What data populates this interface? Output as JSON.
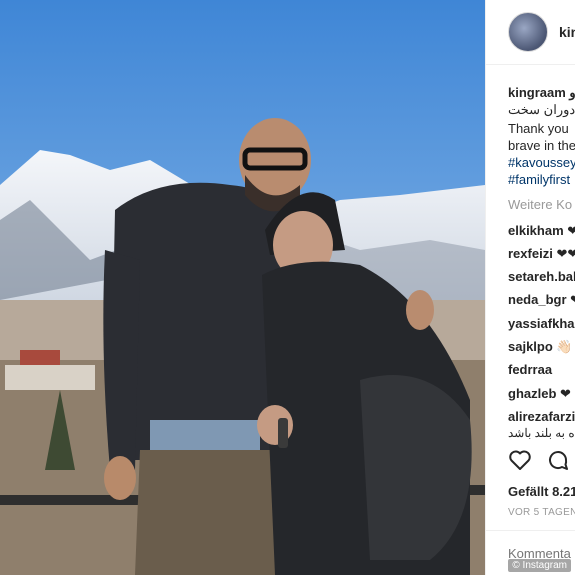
{
  "post": {
    "username": "kingraam",
    "caption_lines": [
      "kingraam و",
      "ن دوران سخت",
      "Thank you",
      "brave in the",
      "#kavoussey",
      "#familyfirst"
    ],
    "more_comments_label": "Weitere Ko",
    "comments": [
      {
        "user": "elkikham",
        "text": "❤"
      },
      {
        "user": "rexfeizi",
        "text": "❤❤"
      },
      {
        "user": "setareh.bah",
        "text": ""
      },
      {
        "user": "neda_bgr",
        "text": "❤"
      },
      {
        "user": "yassiafkhar",
        "text": ""
      },
      {
        "user": "sajklpo",
        "text": "👋🏻"
      },
      {
        "user": "fedrraa",
        "text": ""
      },
      {
        "user": "ghazleb",
        "text": "❤"
      },
      {
        "user": "alirezafarzi",
        "text": ""
      },
      {
        "user": "",
        "text": "ه به بلند باشد"
      }
    ],
    "icons": [
      "heart-icon",
      "comment-icon"
    ],
    "likes_label": "Gefällt 8.21",
    "timestamp": "VOR 5 TAGEN",
    "comment_placeholder": "Kommenta"
  },
  "watermark": "© Instagram"
}
